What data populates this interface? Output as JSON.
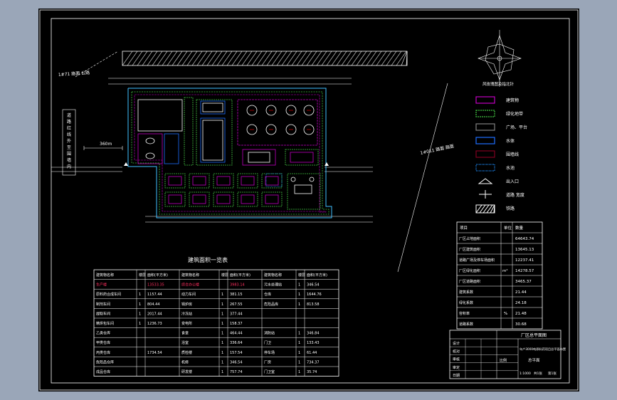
{
  "labels": {
    "road_top_left": "1#71 路面 公路",
    "road_right": "1#011 路面 路面",
    "dimension": "360m",
    "table_title": "建筑面积一览表"
  },
  "vertical_note": [
    "道",
    "路",
    "红",
    "线",
    "外",
    "至",
    "围",
    "墙",
    "内"
  ],
  "legend": [
    {
      "label": "建筑物",
      "color": "#c000c0",
      "kind": "box"
    },
    {
      "label": "绿化地带",
      "color": "#40c040",
      "kind": "dashed"
    },
    {
      "label": "广场、平台",
      "color": "#808080",
      "kind": "box"
    },
    {
      "label": "水体",
      "color": "#1f6fff",
      "kind": "box"
    },
    {
      "label": "围墙线",
      "color": "#800020",
      "kind": "box"
    },
    {
      "label": "水池",
      "color": "#1f8fff",
      "kind": "dotted"
    },
    {
      "label": "出入口",
      "color": "#ffffff",
      "kind": "tri"
    },
    {
      "label": "道路 宽度",
      "color": "#ffffff",
      "kind": "arrow"
    },
    {
      "label": "铁路",
      "color": "#ffffff",
      "kind": "hatch"
    }
  ],
  "compass_label": "风玫瑰图及指北针",
  "stats": {
    "headers": [
      "项目",
      "单位",
      "数量"
    ],
    "unit_1": "m²",
    "unit_2": "%",
    "rows": [
      {
        "name": "厂区占地面积",
        "value": "64643.74"
      },
      {
        "name": "厂区建筑面积",
        "value": "13645.13"
      },
      {
        "name": "道路广场及停车场面积",
        "value": "12237.41"
      },
      {
        "name": "厂区绿化面积",
        "value": "14278.57"
      },
      {
        "name": "厂区道路面积",
        "value": "3465.37"
      },
      {
        "name": "建筑系数",
        "value": "21.44"
      },
      {
        "name": "绿化系数",
        "value": "24.18"
      },
      {
        "name": "容积率",
        "value": "21.48"
      },
      {
        "name": "道路系数",
        "value": "30.68"
      }
    ]
  },
  "area_table": {
    "headers": [
      "建筑物名称",
      "楼层",
      "面积(平方米)",
      "建筑物名称",
      "楼层",
      "面积(平方米)",
      "建筑物名称",
      "楼层",
      "面积(平方米)"
    ],
    "rows": [
      [
        "生产楼",
        "",
        "13533.35",
        "综合办公楼",
        "",
        "3983.14",
        "污水处理站",
        "1",
        "346.54"
      ],
      [
        "原料药合成车间",
        "1",
        "1157.44",
        "动力车间",
        "1",
        "381.15",
        "仓库",
        "1",
        "1644.76"
      ],
      [
        "制剂车间",
        "1",
        "804.44",
        "锅炉房",
        "1",
        "267.55",
        "危险品库",
        "1",
        "813.58"
      ],
      [
        "提取车间",
        "1",
        "2017.44",
        "冷冻站",
        "1",
        "377.44",
        "",
        "",
        ""
      ],
      [
        "精烘包车间",
        "1",
        "1236.73",
        "变电所",
        "1",
        "158.37",
        "",
        "",
        ""
      ],
      [
        "乙类仓库",
        "",
        "",
        "食堂",
        "1",
        "464.44",
        "消防站",
        "1",
        "346.84"
      ],
      [
        "甲类仓库",
        "",
        "",
        "浴室",
        "1",
        "336.64",
        "门卫",
        "1",
        "133.43"
      ],
      [
        "丙类仓库",
        "",
        "1734.54",
        "质检楼",
        "1",
        "157.54",
        "停车场",
        "1",
        "61.44"
      ],
      [
        "危险品仓库",
        "",
        "",
        "机修",
        "1",
        "346.54",
        "厂房",
        "1",
        "734.37"
      ],
      [
        "成品仓库",
        "",
        "",
        "研发楼",
        "1",
        "757.74",
        "门卫室",
        "1",
        "35.74"
      ]
    ]
  },
  "title_block": {
    "title": "厂区总平面图",
    "subtitle": "年产3000吨原料药项目总平面布置",
    "drawing_name": "总平面",
    "scale_label": "比例",
    "rows": [
      "设计",
      "校对",
      "审核",
      "审定",
      "日期"
    ],
    "sheet_info": [
      "1:1000",
      "共1张",
      "第1张"
    ]
  }
}
